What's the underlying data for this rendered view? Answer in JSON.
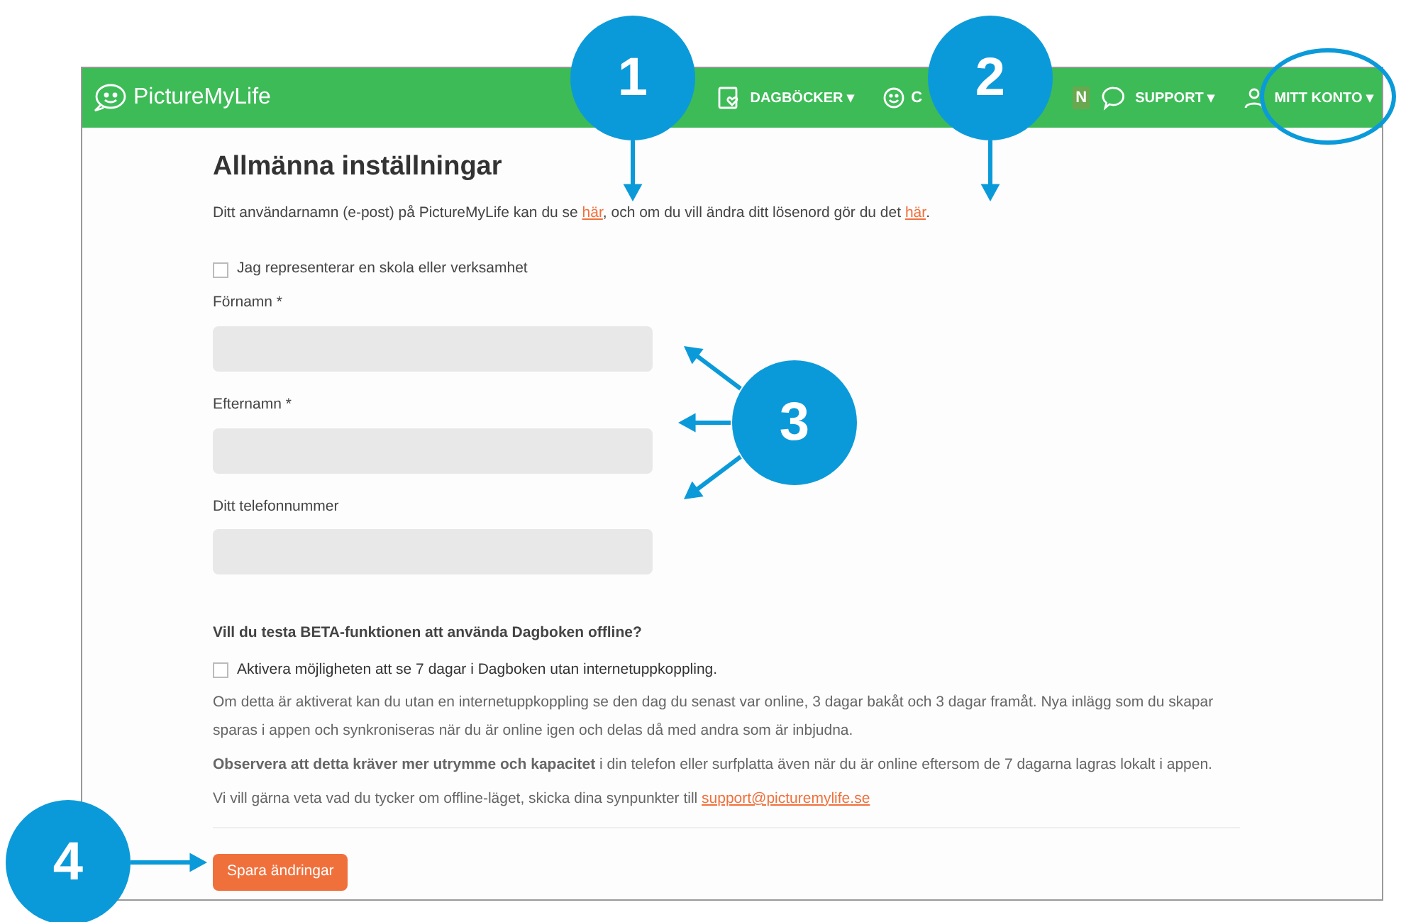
{
  "nav": {
    "logo": "PictureMyLife",
    "items": [
      {
        "kind": "menu",
        "label": "DAGBÖCKER",
        "caret": "▾"
      },
      {
        "kind": "partial",
        "label": "C",
        "tail": "N"
      },
      {
        "kind": "menu",
        "label": "SUPPORT",
        "caret": "▾"
      },
      {
        "kind": "menu",
        "label": "MITT KONTO",
        "caret": "▾"
      }
    ]
  },
  "page": {
    "title": "Allmänna inställningar",
    "intro": [
      {
        "text": "Ditt användarnamn (e-post) på PictureMyLife kan du se "
      },
      {
        "link": "här"
      },
      {
        "text": ", och om du vill ändra ditt lösenord gör du det "
      },
      {
        "link": "här"
      },
      {
        "text": "."
      }
    ],
    "org_checkbox": {
      "label": "Jag representerar en skola eller verksamhet",
      "checked": false
    },
    "fields": [
      {
        "label": "Förnamn *"
      },
      {
        "label": "Efternamn *"
      },
      {
        "label": "Ditt telefonnummer"
      }
    ],
    "beta": {
      "title": "Vill du testa BETA-funktionen att använda Dagboken offline?",
      "checkbox": {
        "label": "Aktivera möjligheten att se 7 dagar i Dagboken utan internetuppkoppling.",
        "checked": false
      },
      "paragraphs": [
        "Om detta är aktiverat kan du utan en internetuppkoppling se den dag du senast var online, 3 dagar bakåt och 3 dagar framåt. Nya inlägg som du skapar sparas i appen och synkroniseras när du är online igen och delas då med andra som är inbjudna.",
        "**Observera att detta kräver mer utrymme och kapacitet** i din telefon eller surfplatta även när du är online eftersom de 7 dagarna lagras lokalt i appen."
      ],
      "feedback": "Vi vill gärna veta vad du tycker om offline-läget, skicka dina synpunkter till ",
      "email": "support@picturemylife.se"
    },
    "save_button": "Spara ändringar"
  },
  "callouts": [
    "1",
    "2",
    "3",
    "4"
  ]
}
